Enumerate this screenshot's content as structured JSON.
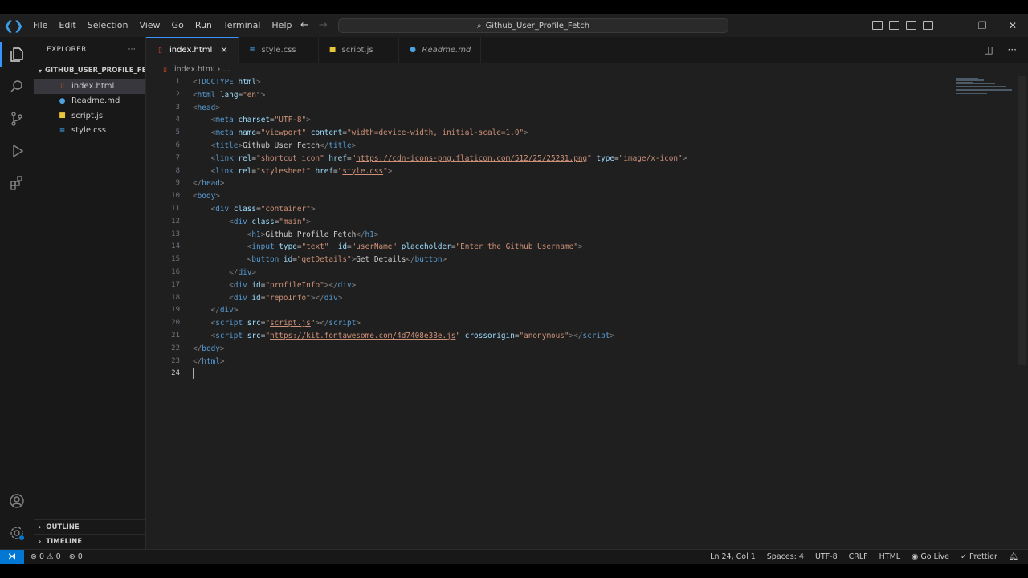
{
  "menu": [
    "File",
    "Edit",
    "Selection",
    "View",
    "Go",
    "Run",
    "Terminal",
    "Help"
  ],
  "search": {
    "text": "Github_User_Profile_Fetch"
  },
  "sidebar": {
    "header": "EXPLORER",
    "folder": "GITHUB_USER_PROFILE_FE...",
    "files": [
      {
        "name": "index.html",
        "type": "html",
        "selected": true
      },
      {
        "name": "Readme.md",
        "type": "md"
      },
      {
        "name": "script.js",
        "type": "js"
      },
      {
        "name": "style.css",
        "type": "css"
      }
    ],
    "outline": "OUTLINE",
    "timeline": "TIMELINE"
  },
  "tabs": [
    {
      "label": "index.html",
      "type": "html",
      "active": true
    },
    {
      "label": "style.css",
      "type": "css"
    },
    {
      "label": "script.js",
      "type": "js"
    },
    {
      "label": "Readme.md",
      "type": "md",
      "italic": true
    }
  ],
  "breadcrumb": {
    "file": "index.html",
    "rest": "..."
  },
  "code": {
    "line_numbers": [
      "1",
      "2",
      "3",
      "4",
      "5",
      "6",
      "7",
      "8",
      "9",
      "10",
      "11",
      "12",
      "13",
      "14",
      "15",
      "16",
      "17",
      "18",
      "19",
      "20",
      "21",
      "22",
      "23",
      "24"
    ],
    "title_text": "Github User Fetch",
    "h1_text": "Github Profile Fetch",
    "button_text": "Get Details",
    "icon_href": "https://cdn-icons-png.flaticon.com/512/25/25231.png",
    "script_src": "script.js",
    "kit_src": "https://kit.fontawesome.com/4d7408e38e.js",
    "placeholder": "Enter the Github Username",
    "css_href": "style.css"
  },
  "status": {
    "errors": "0",
    "warnings": "0",
    "ports": "0",
    "position": "Ln 24, Col 1",
    "spaces": "Spaces: 4",
    "encoding": "UTF-8",
    "eol": "CRLF",
    "language": "HTML",
    "golive": "Go Live",
    "prettier": "Prettier"
  }
}
